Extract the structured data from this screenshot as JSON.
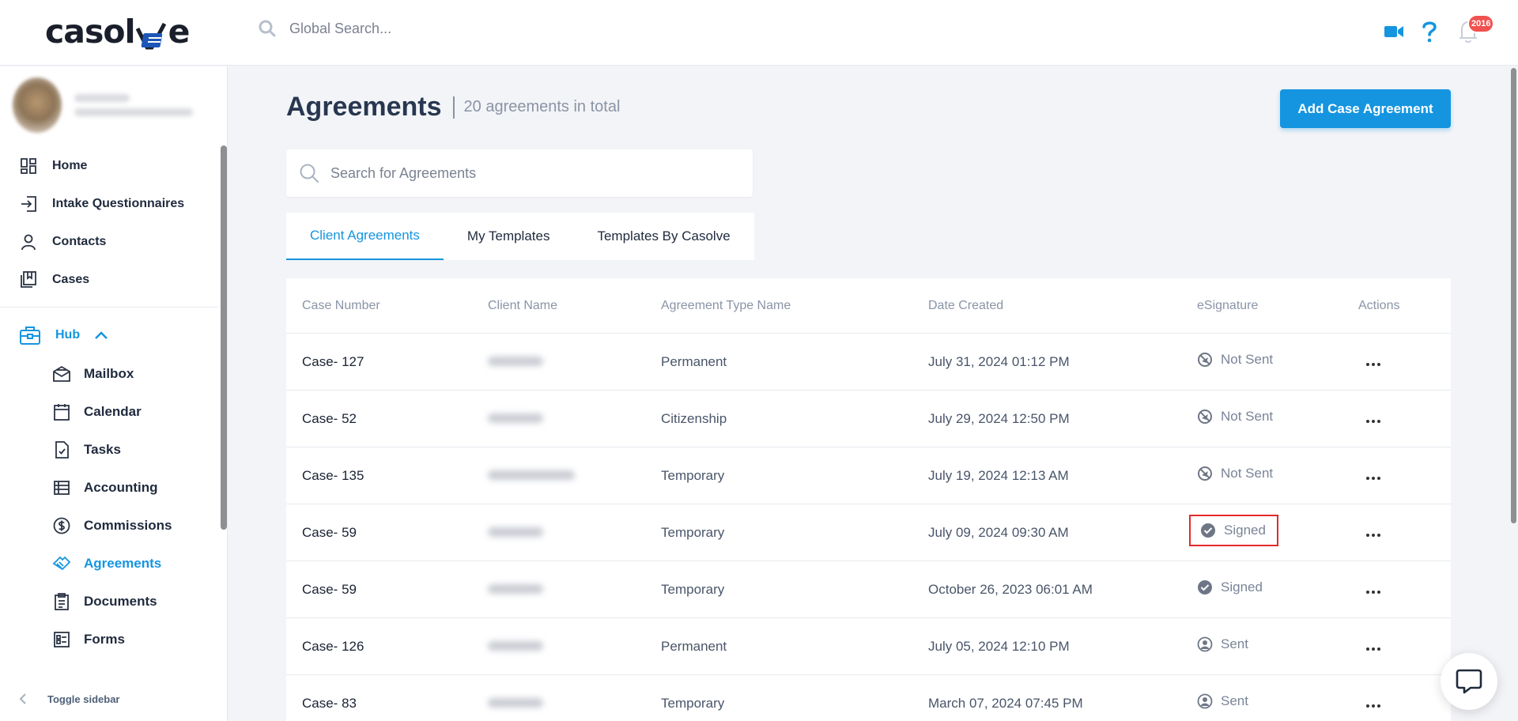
{
  "app": {
    "logo_text": "casolve"
  },
  "topbar": {
    "search_placeholder": "Global Search...",
    "notification_count": "2016"
  },
  "sidebar": {
    "items": [
      {
        "label": "Home",
        "icon": "grid-icon"
      },
      {
        "label": "Intake Questionnaires",
        "icon": "login-icon"
      },
      {
        "label": "Contacts",
        "icon": "user-icon"
      },
      {
        "label": "Cases",
        "icon": "case-icon"
      }
    ],
    "hub": {
      "label": "Hub",
      "icon": "briefcase-icon"
    },
    "hub_items": [
      {
        "label": "Mailbox",
        "icon": "mail-icon"
      },
      {
        "label": "Calendar",
        "icon": "calendar-icon"
      },
      {
        "label": "Tasks",
        "icon": "task-icon"
      },
      {
        "label": "Accounting",
        "icon": "ledger-icon"
      },
      {
        "label": "Commissions",
        "icon": "dollar-icon"
      },
      {
        "label": "Agreements",
        "icon": "handshake-icon",
        "active": true
      },
      {
        "label": "Documents",
        "icon": "document-icon"
      },
      {
        "label": "Forms",
        "icon": "form-icon"
      }
    ],
    "toggle_label": "Toggle sidebar"
  },
  "page": {
    "title": "Agreements",
    "subtitle": "20 agreements in total",
    "add_button": "Add Case Agreement",
    "search_placeholder": "Search for Agreements",
    "tabs": [
      {
        "label": "Client Agreements",
        "active": true
      },
      {
        "label": "My Templates"
      },
      {
        "label": "Templates By Casolve"
      }
    ]
  },
  "table": {
    "columns": [
      "Case Number",
      "Client Name",
      "Agreement Type Name",
      "Date Created",
      "eSignature",
      "Actions"
    ],
    "rows": [
      {
        "case": "Case- 127",
        "type": "Permanent",
        "date": "July 31, 2024 01:12 PM",
        "esig": "Not Sent"
      },
      {
        "case": "Case- 52",
        "type": "Citizenship",
        "date": "July 29, 2024 12:50 PM",
        "esig": "Not Sent"
      },
      {
        "case": "Case- 135",
        "type": "Temporary",
        "date": "July 19, 2024 12:13 AM",
        "esig": "Not Sent"
      },
      {
        "case": "Case- 59",
        "type": "Temporary",
        "date": "July 09, 2024 09:30 AM",
        "esig": "Signed"
      },
      {
        "case": "Case- 59",
        "type": "Temporary",
        "date": "October 26, 2023 06:01 AM",
        "esig": "Signed"
      },
      {
        "case": "Case- 126",
        "type": "Permanent",
        "date": "July 05, 2024 12:10 PM",
        "esig": "Sent"
      },
      {
        "case": "Case- 83",
        "type": "Temporary",
        "date": "March 07, 2024 07:45 PM",
        "esig": "Sent"
      }
    ]
  },
  "colors": {
    "accent": "#1595e0",
    "title": "#283750",
    "highlight": "#e32a2a"
  }
}
